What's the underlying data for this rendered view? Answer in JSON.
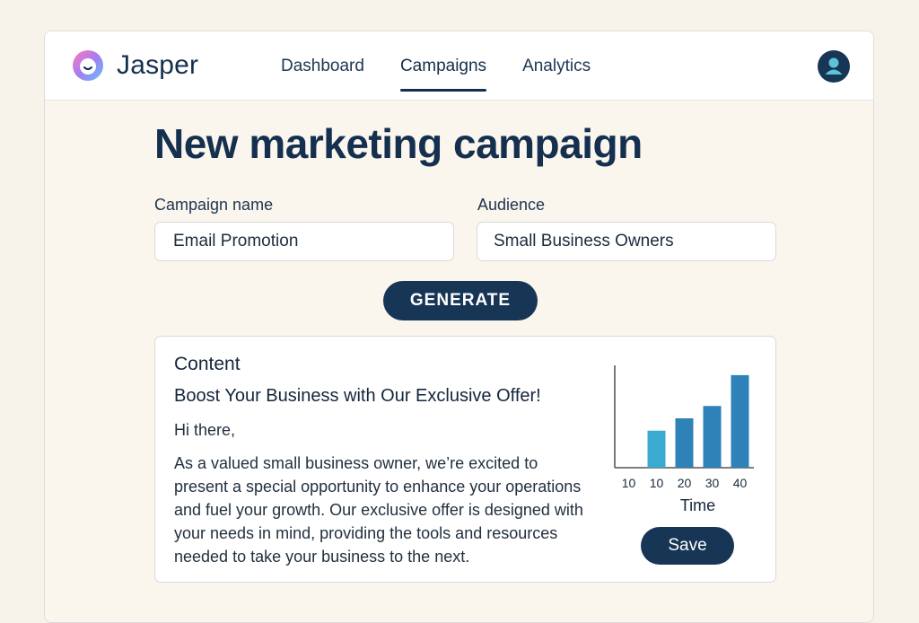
{
  "app": {
    "brand": "Jasper",
    "colors": {
      "primary": "#173656",
      "background": "#f8f3ea",
      "bar": "#2f82b8",
      "bar_first": "#3aaad0"
    }
  },
  "nav": {
    "items": [
      {
        "label": "Dashboard",
        "active": false
      },
      {
        "label": "Campaigns",
        "active": true
      },
      {
        "label": "Analytics",
        "active": false
      }
    ],
    "avatar_icon": "user-icon"
  },
  "page": {
    "title": "New marketing campaign"
  },
  "form": {
    "campaign_name_label": "Campaign name",
    "campaign_name_value": "Email Promotion",
    "audience_label": "Audience",
    "audience_value": "Small Business Owners",
    "generate_label": "GENERATE"
  },
  "content": {
    "heading": "Content",
    "subject": "Boost Your Business with Our Exclusive Offer!",
    "greeting": "Hi there,",
    "body": "As a valued small business owner, we’re excited to present a special opportunity to enhance your operations and fuel your growth. Our exclusive offer is designed with your needs in mind, providing the tools and resources needed to take your business to the next.",
    "save_label": "Save"
  },
  "chart_data": {
    "type": "bar",
    "categories": [
      "10",
      "10",
      "20",
      "30",
      "40"
    ],
    "values": [
      0,
      3,
      4,
      5,
      7.5
    ],
    "xlabel": "Time",
    "ylabel": "",
    "ylim": [
      0,
      8
    ],
    "grid": false
  }
}
